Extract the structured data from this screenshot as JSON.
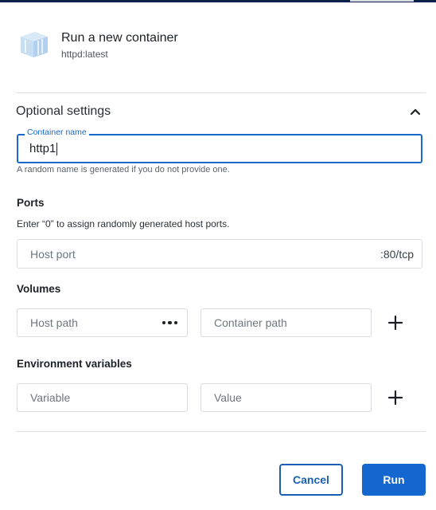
{
  "header": {
    "title": "Run a new container",
    "subtitle": "httpd:latest"
  },
  "optional_settings": {
    "label": "Optional settings",
    "expanded": true
  },
  "container_name": {
    "label": "Container name",
    "value": "http1",
    "helper": "A random name is generated if you do not provide one."
  },
  "ports": {
    "title": "Ports",
    "description": "Enter “0” to assign randomly generated host ports.",
    "host_port_placeholder": "Host port",
    "container_port": ":80/tcp"
  },
  "volumes": {
    "title": "Volumes",
    "host_path_placeholder": "Host path",
    "container_path_placeholder": "Container path"
  },
  "env": {
    "title": "Environment variables",
    "variable_placeholder": "Variable",
    "value_placeholder": "Value"
  },
  "actions": {
    "cancel": "Cancel",
    "run": "Run"
  },
  "colors": {
    "accent": "#1467cf",
    "logo": "#bcd7f0",
    "top_bar": "#0b214a"
  },
  "icons": {
    "logo": "container-box-icon",
    "toggle": "chevron-up-icon",
    "browse": "more-horizontal-icon",
    "add": "plus-icon"
  }
}
